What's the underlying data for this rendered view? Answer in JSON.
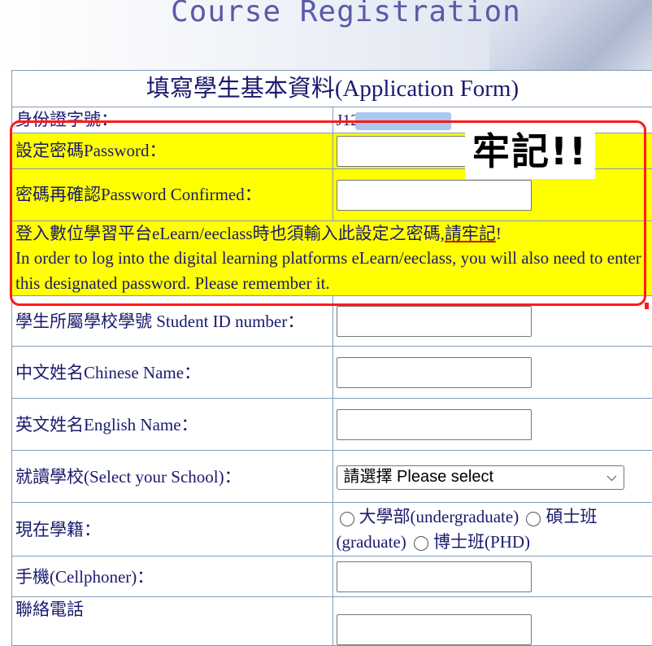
{
  "banner": {
    "title": "Course Registration"
  },
  "form": {
    "header": "填寫學生基本資料(Application Form)",
    "id_label": "身份證字號：",
    "id_value": "J12",
    "password_label": "設定密碼Password：",
    "password_confirm_label": "密碼再確認Password Confirmed：",
    "notice_zh_prefix": "登入數位學習平台eLearn/eeclass時也須輸入此設定之密碼,",
    "notice_zh_emphasis": "請牢記",
    "notice_zh_suffix": "!",
    "notice_en": "In order to log into the digital learning platforms eLearn/eeclass, you will also need to enter this designated password. Please remember it.",
    "student_id_label": "學生所屬學校學號 Student ID number：",
    "chinese_name_label": "中文姓名Chinese Name：",
    "english_name_label": "英文姓名English Name：",
    "school_label": "就讀學校(Select your School)：",
    "school_selected": "請選擇 Please select",
    "status_label": "現在學籍：",
    "status_options": [
      "大學部(undergraduate)",
      "碩士班(graduate)",
      "博士班(PHD)"
    ],
    "cellphone_label": "手機(Cellphoner)：",
    "phone_label": "聯絡電話"
  },
  "annotation": {
    "sticky_text": "牢記!!"
  },
  "colors": {
    "accent_red": "#ff1a1a",
    "highlight_yellow": "#ffff00",
    "label_text": "#1a1a6e",
    "banner_text": "#5a5aa8"
  }
}
